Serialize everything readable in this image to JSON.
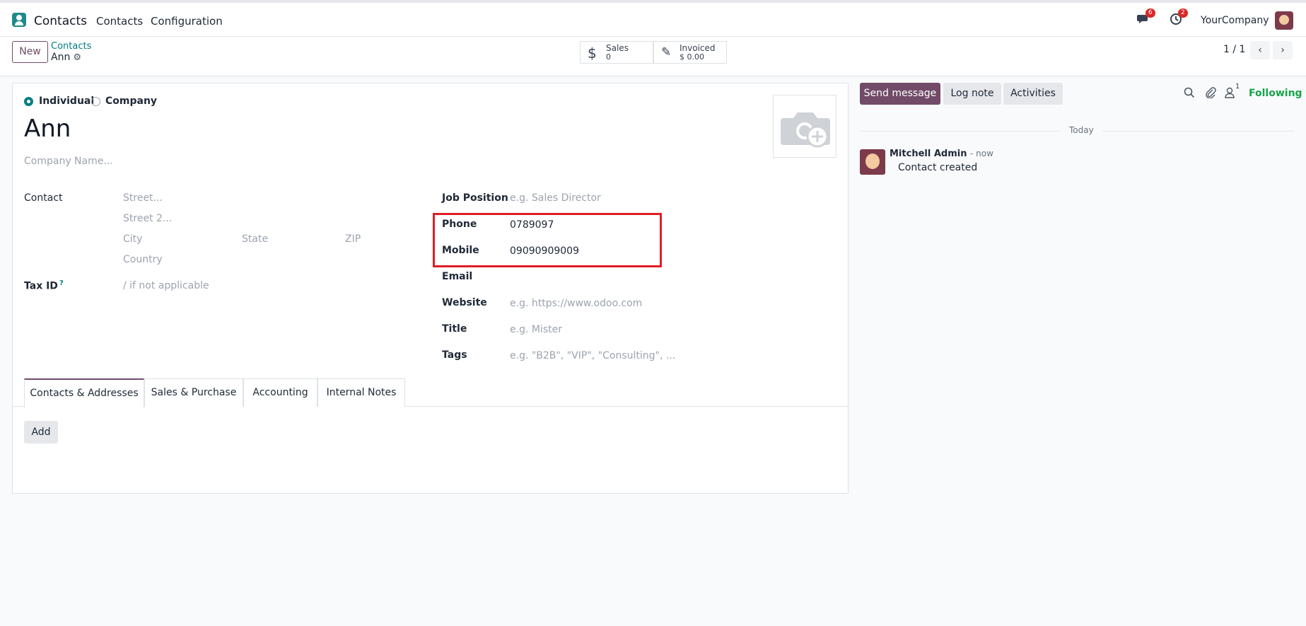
{
  "topbar": {
    "app_name": "Contacts",
    "menu": [
      "Contacts",
      "Configuration"
    ],
    "messages_count": "6",
    "activities_count": "2",
    "company": "YourCompany"
  },
  "control": {
    "new_label": "New",
    "breadcrumb_parent": "Contacts",
    "breadcrumb_current": "Ann",
    "sales_label": "Sales",
    "sales_value": "0",
    "invoiced_label": "Invoiced",
    "invoiced_value": "$ 0.00",
    "pager": "1 / 1"
  },
  "form": {
    "type_individual": "Individual",
    "type_company": "Company",
    "name": "Ann",
    "company_placeholder": "Company Name...",
    "contact_label": "Contact",
    "street_ph": "Street...",
    "street2_ph": "Street 2...",
    "city_ph": "City",
    "state_ph": "State",
    "zip_ph": "ZIP",
    "country_ph": "Country",
    "tax_label": "Tax ID",
    "tax_sup": "?",
    "tax_ph": "/ if not applicable",
    "job_label": "Job Position",
    "job_ph": "e.g. Sales Director",
    "phone_label": "Phone",
    "phone_value": "0789097",
    "mobile_label": "Mobile",
    "mobile_value": "09090909009",
    "email_label": "Email",
    "website_label": "Website",
    "website_ph": "e.g. https://www.odoo.com",
    "title_label": "Title",
    "title_ph": "e.g. Mister",
    "tags_label": "Tags",
    "tags_ph": "e.g. \"B2B\", \"VIP\", \"Consulting\", ..."
  },
  "tabs": [
    "Contacts & Addresses",
    "Sales & Purchase",
    "Accounting",
    "Internal Notes"
  ],
  "add_label": "Add",
  "chatter": {
    "send_message": "Send message",
    "log_note": "Log note",
    "activities": "Activities",
    "followers_count": "1",
    "following": "Following",
    "today": "Today",
    "author": "Mitchell Admin",
    "time": "- now",
    "body": "Contact created"
  }
}
